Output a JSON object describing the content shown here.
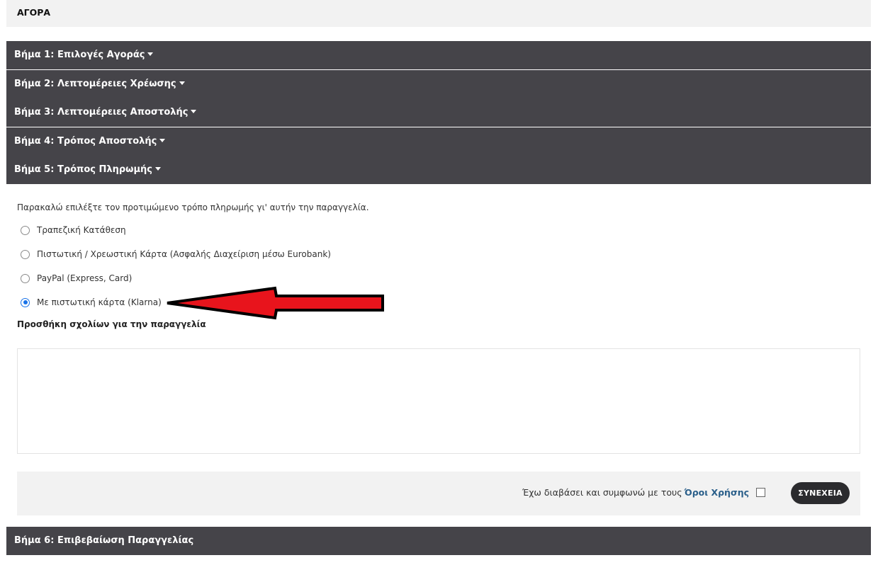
{
  "page": {
    "title": "ΑΓΟΡΑ"
  },
  "steps": [
    {
      "label": "Βήμα 1: Επιλογές Αγοράς"
    },
    {
      "label": "Βήμα 2: Λεπτομέρειες Χρέωσης"
    },
    {
      "label": "Βήμα 3: Λεπτομέρειες Αποστολής"
    },
    {
      "label": "Βήμα 4: Τρόπος Αποστολής"
    },
    {
      "label": "Βήμα 5: Τρόπος Πληρωμής"
    },
    {
      "label": "Βήμα 6: Επιβεβαίωση Παραγγελίας"
    }
  ],
  "payment": {
    "intro": "Παρακαλώ επιλέξτε τον προτιμώμενο τρόπο πληρωμής γι' αυτήν την παραγγελία.",
    "options": [
      {
        "label": "Τραπεζική Κατάθεση",
        "selected": false
      },
      {
        "label": "Πιστωτική / Χρεωστική Κάρτα (Ασφαλής Διαχείριση μέσω Eurobank)",
        "selected": false
      },
      {
        "label": "PayPal (Express, Card)",
        "selected": false
      },
      {
        "label": "Με πιστωτική κάρτα (Klarna)",
        "selected": true
      }
    ]
  },
  "comments": {
    "label": "Προσθήκη σχολίων για την παραγγελία",
    "value": ""
  },
  "footer": {
    "agree_text": "Έχω διαβάσει και συμφωνώ με τους",
    "terms_link": "Όροι Χρήσης",
    "continue_label": "ΣΥΝΕΧΕΙΑ"
  },
  "colors": {
    "step_header_bg": "#454449",
    "radio_accent": "#1a73e8",
    "annotation_arrow": "#e8141c",
    "link": "#2a5f8a"
  }
}
